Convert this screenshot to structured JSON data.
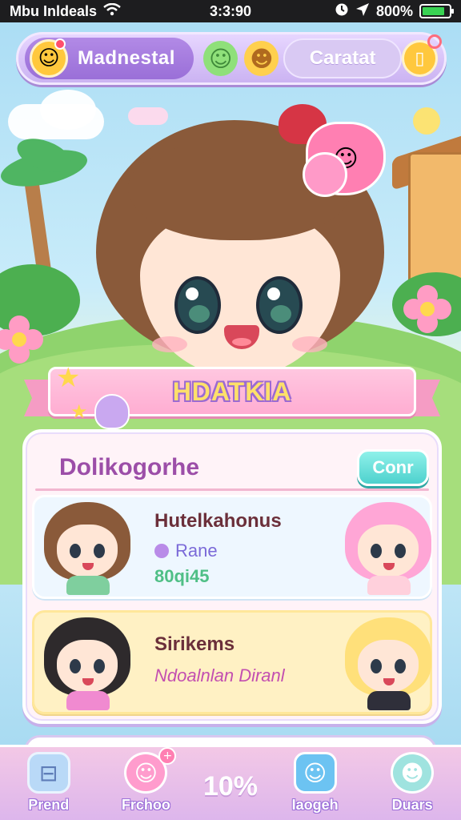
{
  "status_bar": {
    "carrier": "Mbu Inldeals",
    "time": "3:3:90",
    "battery_percent": "800%",
    "battery_level": 0.85
  },
  "top_bar": {
    "left_pill_label": "Madnestal",
    "right_pill_label": "Caratat",
    "icons": [
      "smiley-face-icon",
      "green-mascot-icon",
      "yellow-cat-icon",
      "document-icon"
    ]
  },
  "banner": {
    "title": "HDATKIA"
  },
  "card": {
    "title": "Dolikogorhe",
    "cont_button": "Conr",
    "rows": [
      {
        "name": "Hutelkahonus",
        "status_label": "Rane",
        "value": "80qi45"
      },
      {
        "name": "Sirikems",
        "subtitle": "Ndoalnlan Diranl"
      }
    ]
  },
  "bottom_nav": {
    "items": [
      {
        "label": "Prend",
        "icon": "cart-icon"
      },
      {
        "label": "Frchoo",
        "icon": "friend-icon"
      },
      {
        "label": "Iaogeh",
        "icon": "chat-icon"
      },
      {
        "label": "Duars",
        "icon": "pet-icon"
      }
    ],
    "center_text": "10%"
  },
  "colors": {
    "accent_purple": "#9a6fd8",
    "banner_pink": "#ffadd2",
    "button_teal": "#4ed1cd",
    "battery_green": "#39d353"
  }
}
